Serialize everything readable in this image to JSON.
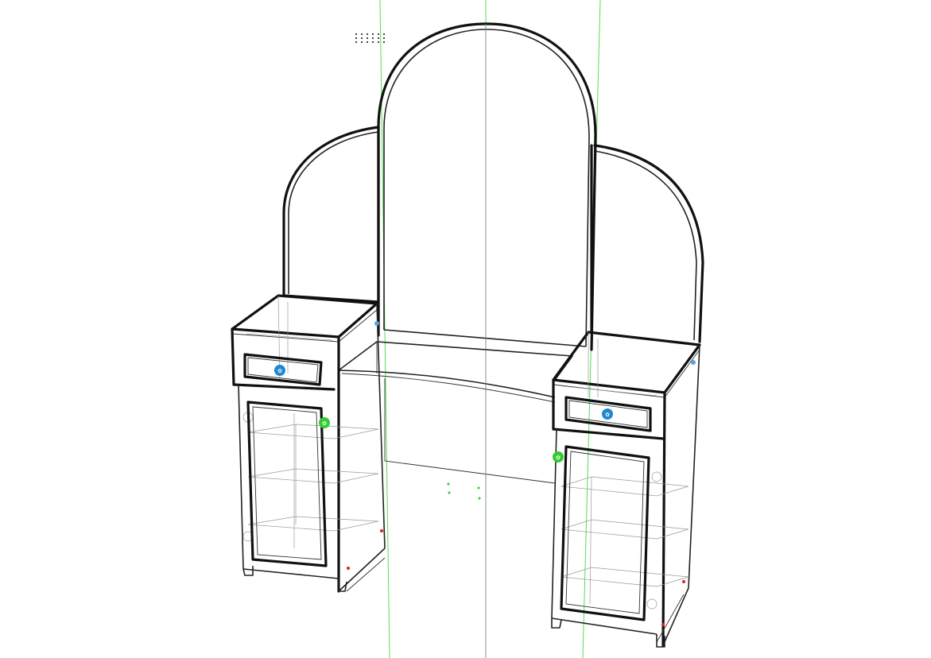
{
  "viewport": {
    "background": "#ffffff",
    "axis_colors": {
      "vertical_axis": "#55dd55",
      "center_axis": "#8a8a8a"
    }
  },
  "model": {
    "object": "dressing-table-with-mirrors",
    "render_style": "hidden-line wireframe",
    "mirrors": [
      "left-side-mirror",
      "center-arched-mirror",
      "right-side-mirror"
    ],
    "cabinets": [
      {
        "side": "left",
        "drawer_handle_icon": "blue-handle-marker",
        "door_handle_icon": "green-handle-marker"
      },
      {
        "side": "right",
        "drawer_handle_icon": "blue-handle-marker",
        "door_handle_icon": "green-handle-marker"
      }
    ],
    "marker_colors": {
      "drawer_handle": "#1e88d0",
      "door_handle": "#33cc33",
      "fastener": "#dd2222"
    }
  }
}
